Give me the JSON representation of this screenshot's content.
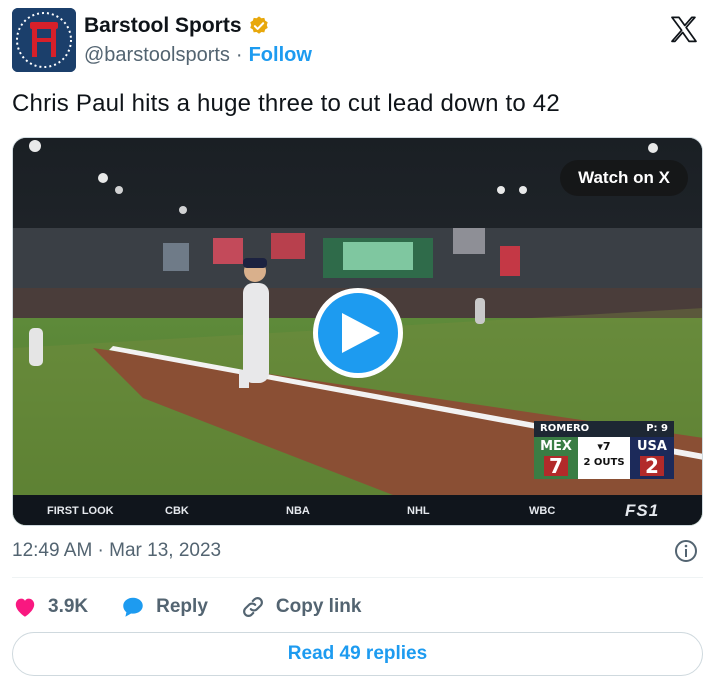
{
  "author": {
    "display_name": "Barstool Sports",
    "handle": "@barstoolsports",
    "separator": "·",
    "follow_label": "Follow",
    "verified_color": "#e8a80c"
  },
  "tweet": {
    "text": "Chris Paul hits a huge three to cut lead down to 42",
    "timestamp": "12:49 AM · Mar 13, 2023"
  },
  "media": {
    "watch_label": "Watch on X",
    "scorebug": {
      "pitcher": "ROMERO",
      "pitch_count": "P: 9",
      "away_team": "MEX",
      "away_score": "7",
      "inning": "▾7",
      "outs": "2 OUTS",
      "home_team": "USA",
      "home_score": "2"
    },
    "ticker": [
      "FIRST LOOK",
      "CBK",
      "NBA",
      "NHL",
      "WBC"
    ],
    "network": "FS1"
  },
  "actions": {
    "likes": "3.9K",
    "reply_label": "Reply",
    "copy_link_label": "Copy link"
  },
  "read_replies_label": "Read 49 replies",
  "colors": {
    "accent": "#1d9bf0",
    "like": "#f91880",
    "muted": "#536471"
  }
}
